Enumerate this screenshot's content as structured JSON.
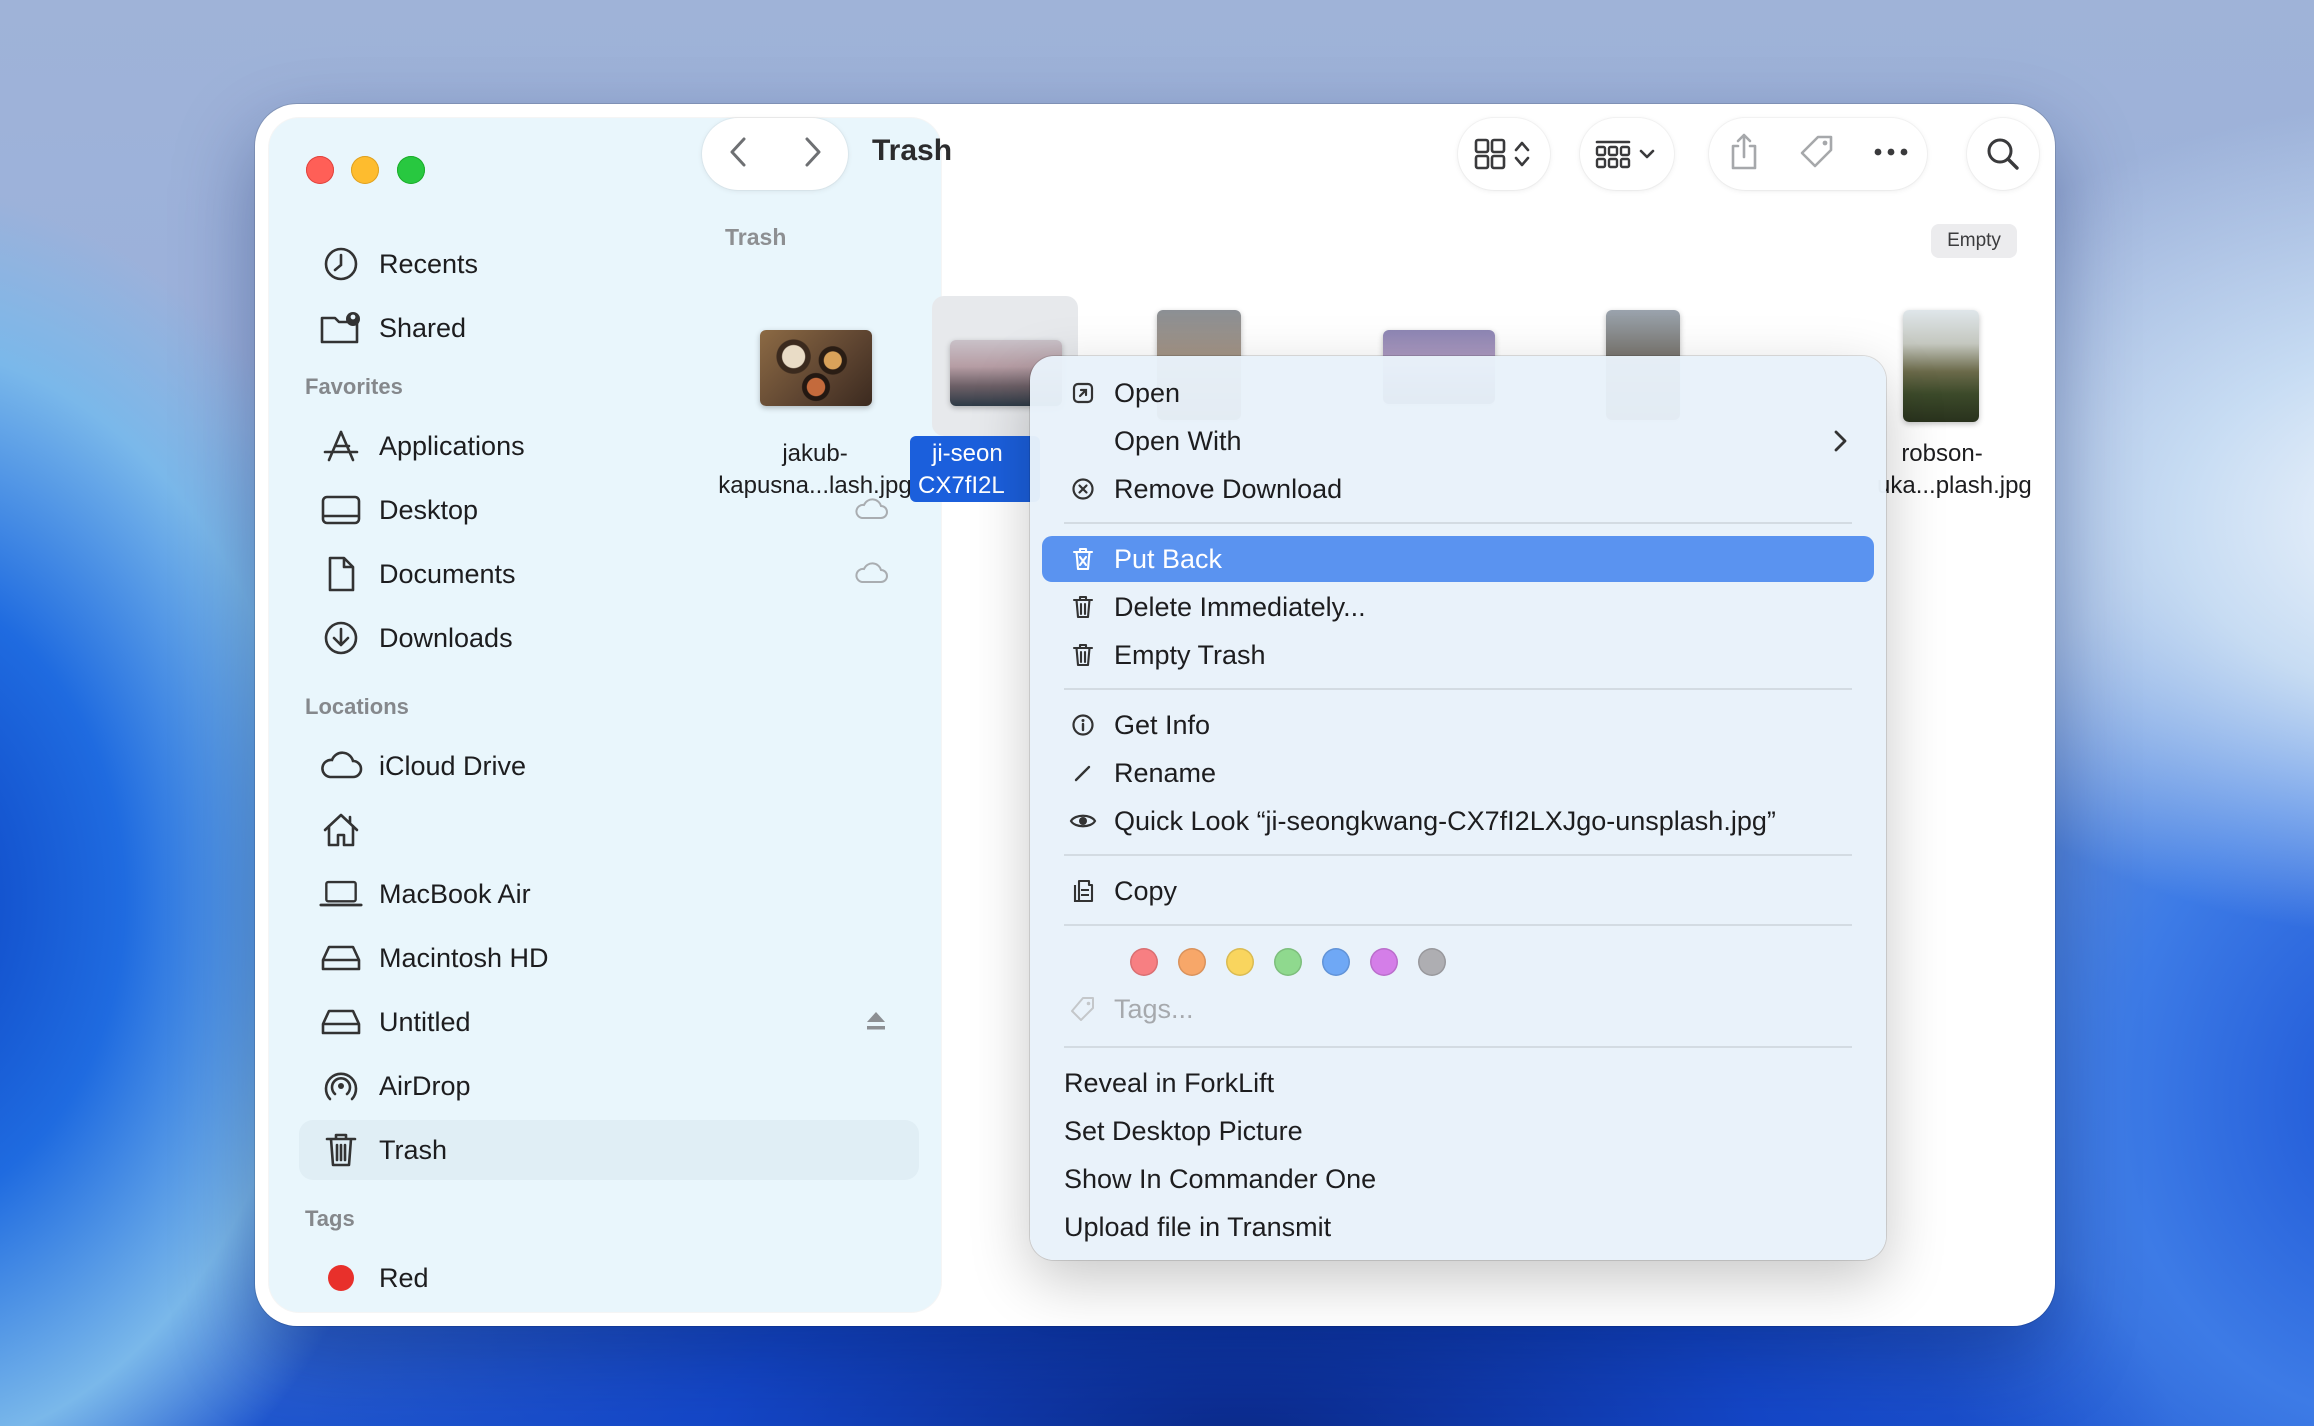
{
  "window": {
    "title": "Trash"
  },
  "sidebar": {
    "top_items": [
      {
        "label": "Recents",
        "icon": "clock-icon"
      },
      {
        "label": "Shared",
        "icon": "shared-folder-icon"
      }
    ],
    "favorites_header": "Favorites",
    "favorites": [
      {
        "label": "Applications",
        "icon": "applications-icon"
      },
      {
        "label": "Desktop",
        "icon": "desktop-icon"
      },
      {
        "label": "Documents",
        "icon": "document-icon"
      },
      {
        "label": "Downloads",
        "icon": "download-icon"
      }
    ],
    "locations_header": "Locations",
    "locations": [
      {
        "label": "iCloud Drive",
        "icon": "cloud-icon"
      },
      {
        "label": "",
        "icon": "home-icon"
      },
      {
        "label": "MacBook Air",
        "icon": "laptop-icon"
      },
      {
        "label": "Macintosh HD",
        "icon": "drive-icon"
      },
      {
        "label": "Untitled",
        "icon": "drive-icon"
      },
      {
        "label": "AirDrop",
        "icon": "airdrop-icon"
      },
      {
        "label": "Trash",
        "icon": "trash-icon"
      }
    ],
    "tags_header": "Tags",
    "tags": [
      {
        "label": "Red",
        "color": "#e8302b"
      }
    ]
  },
  "content": {
    "path_label": "Trash",
    "empty_button": "Empty",
    "files": [
      {
        "line1": "jakub-",
        "line2": "kapusna...lash.jpg"
      },
      {
        "line1": "ji-seon",
        "line2": "CX7fI2L"
      },
      {
        "line1": "robson-",
        "line2": "uka...plash.jpg"
      }
    ]
  },
  "context_menu": {
    "open": "Open",
    "open_with": "Open With",
    "remove_download": "Remove Download",
    "put_back": "Put Back",
    "delete_immediately": "Delete Immediately...",
    "empty_trash": "Empty Trash",
    "get_info": "Get Info",
    "rename": "Rename",
    "quick_look": "Quick Look “ji-seongkwang-CX7fI2LXJgo-unsplash.jpg”",
    "copy": "Copy",
    "tag_colors": [
      "#f77f82",
      "#f7a769",
      "#f9d55e",
      "#8fd98e",
      "#6fa8f5",
      "#d47ee8",
      "#aeaeb2"
    ],
    "tags_placeholder": "Tags...",
    "reveal_forklift": "Reveal in ForkLift",
    "set_desktop_picture": "Set Desktop Picture",
    "show_commander_one": "Show In Commander One",
    "upload_transmit": "Upload file in Transmit"
  }
}
